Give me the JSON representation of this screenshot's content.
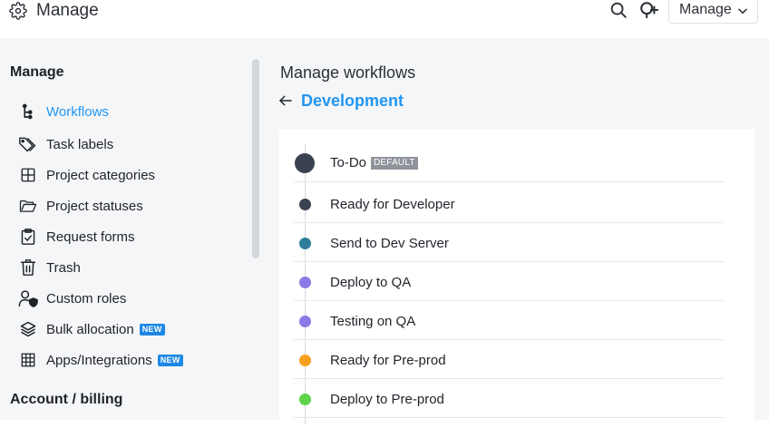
{
  "header": {
    "title": "Manage",
    "manage_button": "Manage"
  },
  "sidebar": {
    "section_manage": "Manage",
    "items": [
      {
        "label": "Workflows",
        "icon": "workflow-icon",
        "active": true,
        "badge": ""
      },
      {
        "label": "Task labels",
        "icon": "tag-icon",
        "active": false,
        "badge": ""
      },
      {
        "label": "Project categories",
        "icon": "grid-icon",
        "active": false,
        "badge": ""
      },
      {
        "label": "Project statuses",
        "icon": "folder-icon",
        "active": false,
        "badge": ""
      },
      {
        "label": "Request forms",
        "icon": "clipboard-check-icon",
        "active": false,
        "badge": ""
      },
      {
        "label": "Trash",
        "icon": "trash-icon",
        "active": false,
        "badge": ""
      },
      {
        "label": "Custom roles",
        "icon": "user-shield-icon",
        "active": false,
        "badge": ""
      },
      {
        "label": "Bulk allocation",
        "icon": "layers-icon",
        "active": false,
        "badge": "NEW"
      },
      {
        "label": "Apps/Integrations",
        "icon": "apps-grid-icon",
        "active": false,
        "badge": "NEW"
      }
    ],
    "section_account": "Account / billing"
  },
  "content": {
    "title": "Manage workflows",
    "workflow_name": "Development",
    "default_badge": "DEFAULT",
    "statuses": [
      {
        "name": "To-Do",
        "color": "#3a4150",
        "default": true
      },
      {
        "name": "Ready for Developer",
        "color": "#3a4150",
        "default": false
      },
      {
        "name": "Send to Dev Server",
        "color": "#2e7d9a",
        "default": false
      },
      {
        "name": "Deploy to QA",
        "color": "#8c7ae6",
        "default": false
      },
      {
        "name": "Testing on QA",
        "color": "#8c7ae6",
        "default": false
      },
      {
        "name": "Ready for Pre-prod",
        "color": "#f7a01d",
        "default": false
      },
      {
        "name": "Deploy to Pre-prod",
        "color": "#5fd449",
        "default": false
      }
    ]
  },
  "colors": {
    "accent": "#2196f3",
    "badge_new": "#1e88e5"
  }
}
